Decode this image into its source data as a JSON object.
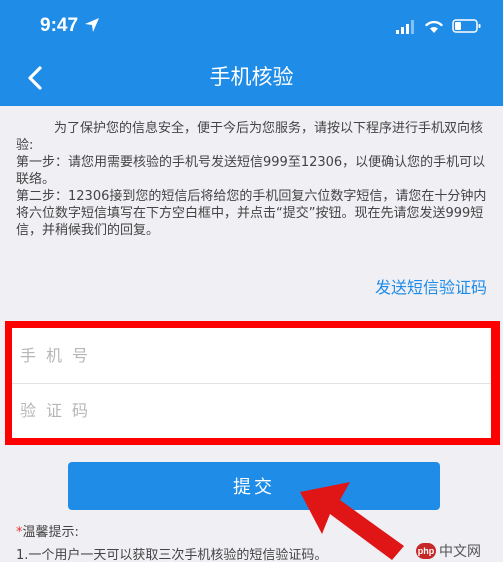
{
  "status_bar": {
    "time": "9:47"
  },
  "nav": {
    "title": "手机核验"
  },
  "intro": {
    "paragraph1": "为了保护您的信息安全，便于今后为您服务，请按以下程序进行手机双向核验:",
    "step1": "第一步：请您用需要核验的手机号发送短信999至12306，以便确认您的手机可以联络。",
    "step2": "第二步：12306接到您的短信后将给您的手机回复六位数字短信，请您在十分钟内将六位数字短信填写在下方空白框中，并点击“提交”按钮。现在先请您发送999短信，并稍候我们的回复。"
  },
  "send_code_link": "发送短信验证码",
  "form": {
    "phone": {
      "placeholder": "手机号",
      "value": ""
    },
    "code": {
      "placeholder": "验证码",
      "value": ""
    }
  },
  "submit_label": "提交",
  "tips": {
    "marker": "*",
    "title": "温馨提示:",
    "items": [
      "1.一个用户一天可以获取三次手机核验的短信验证码。"
    ]
  },
  "watermark": {
    "logo": "php",
    "text": "中文网"
  },
  "colors": {
    "primary": "#1f8ce8",
    "highlight": "#ff0000",
    "background": "#efeff4"
  }
}
